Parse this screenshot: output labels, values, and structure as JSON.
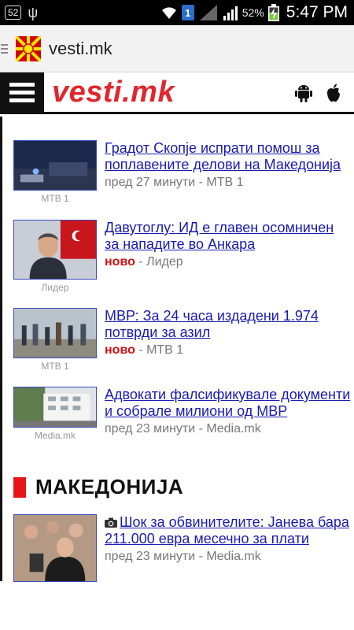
{
  "status_bar": {
    "notif_badge": "52",
    "sim_badge": "1",
    "battery_pct": "52%",
    "time": "5:47 PM"
  },
  "browser": {
    "title": "vesti.mk"
  },
  "site": {
    "logo": "vesti.mk",
    "logo_color": "#e1262d"
  },
  "articles": [
    {
      "headline": "Градот Скопје испрати помош за поплавените делови на Македонија",
      "thumb_caption": "МТВ 1",
      "meta_time": "пред 27 минути",
      "meta_source": "МТВ 1",
      "is_new": false
    },
    {
      "headline": "Давутоглу: ИД е главен осомничен за нападите во Анкара",
      "thumb_caption": "Лидер",
      "meta_new_label": "ново",
      "meta_source": "Лидер",
      "is_new": true
    },
    {
      "headline": "МВР: За 24 часа издадени 1.974 потврди за азил",
      "thumb_caption": "МТВ 1",
      "meta_new_label": "ново",
      "meta_source": "МТВ 1",
      "is_new": true
    },
    {
      "headline": "Адвокати фалсификувале документи и собрале милиони од МВР",
      "thumb_caption": "Media.mk",
      "meta_time": "пред 23 минути",
      "meta_source": "Media.mk",
      "is_new": false
    }
  ],
  "section": {
    "title": "МАКЕДОНИЈА",
    "accent": "#e8141a"
  },
  "section_articles": [
    {
      "headline": "Шок за обвинителите: Јанева бара 211.000 евра месечно за плати",
      "meta_time": "пред 23 минути",
      "meta_source": "Media.mk"
    }
  ]
}
